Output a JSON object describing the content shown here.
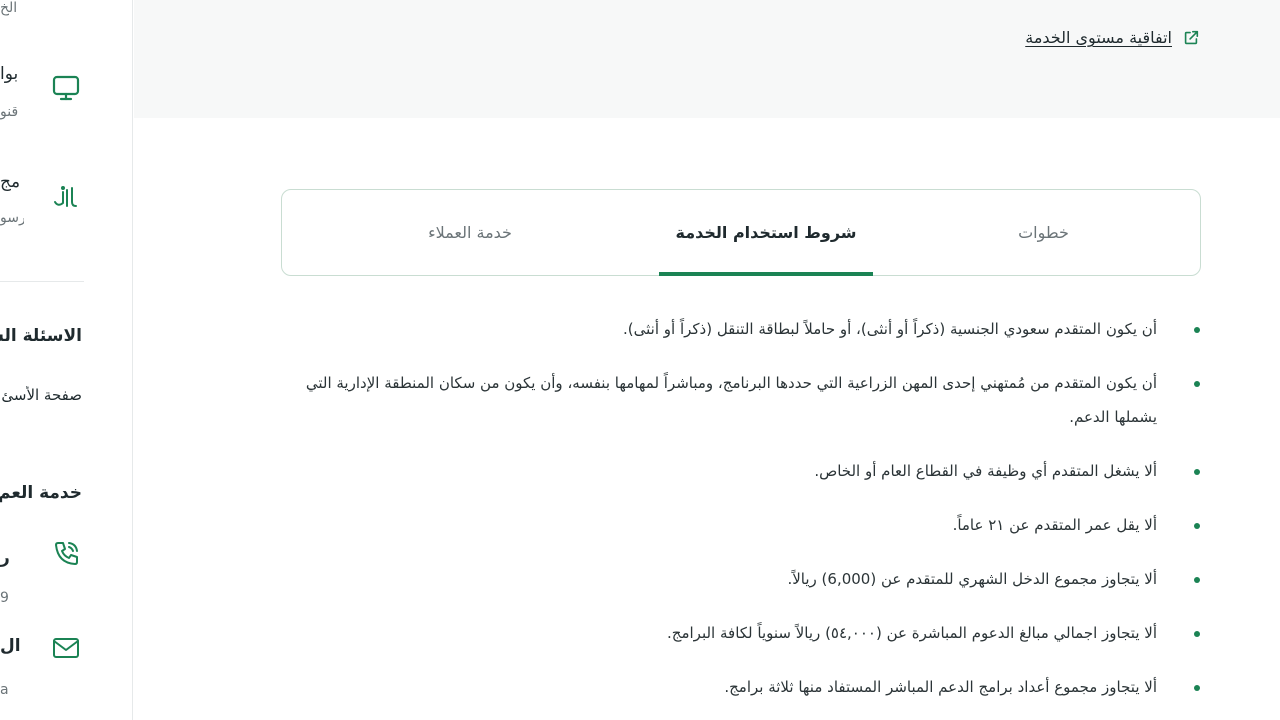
{
  "sidebar": {
    "top_cut_text": "الخ",
    "items": [
      {
        "title": "بوا",
        "subtitle": "قنو",
        "icon": "monitor-icon"
      },
      {
        "title": "مج",
        "subtitle": "رسو",
        "icon": "riyal-icon"
      }
    ],
    "faq_heading": "الاسئلة الش",
    "faq_link": "صفحة الأسئ",
    "support_heading": "خدمة العم",
    "contacts": [
      {
        "title": "ر",
        "subtitle": "9",
        "icon": "phone-icon"
      },
      {
        "title": "ال",
        "subtitle": "a",
        "icon": "mail-icon"
      }
    ]
  },
  "banner": {
    "sla_link": "اتفاقية مستوى الخدمة",
    "sla_icon": "external-link-icon"
  },
  "tabs": [
    {
      "label": "خطوات",
      "active": false
    },
    {
      "label": "شروط استخدام الخدمة",
      "active": true
    },
    {
      "label": "خدمة العملاء",
      "active": false
    }
  ],
  "terms": [
    "أن يكون المتقدم سعودي الجنسية (ذكراً أو أنثى)، أو حاملاً لبطاقة التنقل (ذكراً أو أنثى).",
    "أن يكون المتقدم من مُمتهني إحدى المهن الزراعية التي حددها البرنامج، ومباشراً لمهامها بنفسه، وأن يكون من سكان المنطقة الإدارية التي يشملها الدعم.",
    "ألا يشغل المتقدم أي وظيفة في القطاع العام أو الخاص.",
    "ألا يقل عمر المتقدم عن ٢١ عاماً.",
    "ألا يتجاوز مجموع الدخل الشهري للمتقدم عن (6,000) ريالاً.",
    "ألا يتجاوز اجمالي مبالغ الدعوم المباشرة عن (٥٤,٠٠٠) ريالاً سنوياً لكافة البرامج.",
    "ألا يتجاوز مجموع أعداد برامج الدعم المباشر المستفاد منها ثلاثة برامج."
  ],
  "colors": {
    "accent": "#1b8354",
    "text": "#1f2a2e",
    "muted": "#6b7478",
    "banner_bg": "#f7f8f8"
  }
}
